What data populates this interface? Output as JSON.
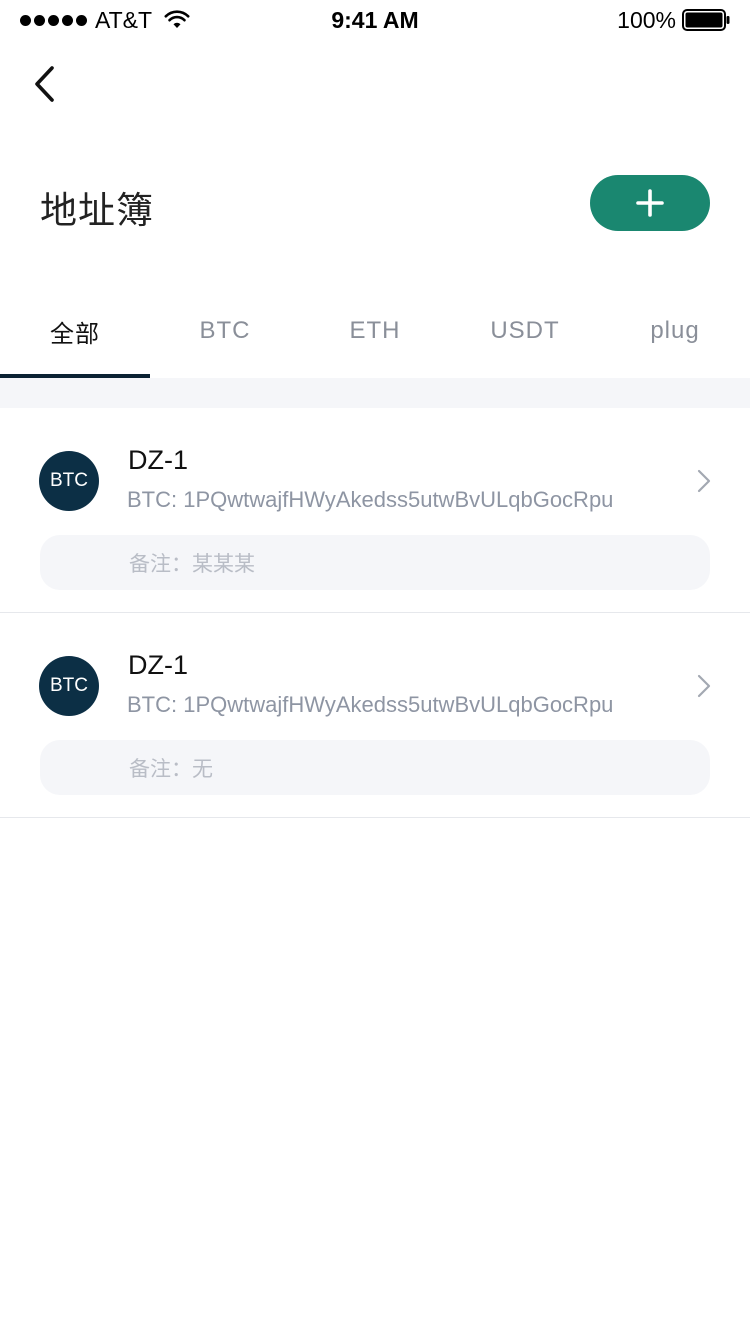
{
  "status_bar": {
    "carrier": "AT&T",
    "time": "9:41 AM",
    "battery": "100%"
  },
  "header": {
    "title": "地址簿"
  },
  "tabs": [
    {
      "label": "全部",
      "active": true
    },
    {
      "label": "BTC",
      "active": false
    },
    {
      "label": "ETH",
      "active": false
    },
    {
      "label": "USDT",
      "active": false
    },
    {
      "label": "plug",
      "active": false
    }
  ],
  "addresses": [
    {
      "coin": "BTC",
      "name": "DZ-1",
      "address": "BTC: 1PQwtwajfHWyAkedss5utwBvULqbGocRpu",
      "note": "备注：某某某"
    },
    {
      "coin": "BTC",
      "name": "DZ-1",
      "address": "BTC: 1PQwtwajfHWyAkedss5utwBvULqbGocRpu",
      "note": "备注：无"
    }
  ],
  "colors": {
    "accent": "#1a8770",
    "avatar": "#0c2f45",
    "tab_indicator": "#0b2233"
  }
}
